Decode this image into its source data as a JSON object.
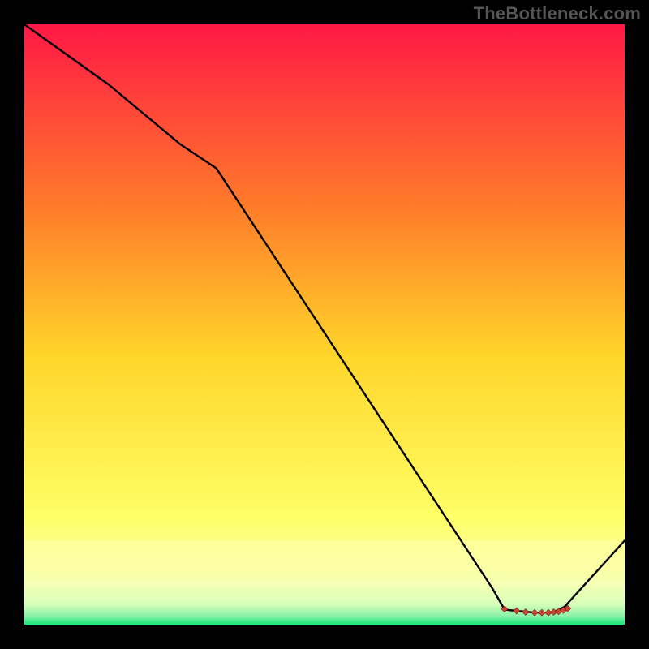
{
  "watermark": "TheBottleneck.com",
  "chart_data": {
    "type": "line",
    "title": "",
    "xlabel": "",
    "ylabel": "",
    "xlim": [
      0,
      100
    ],
    "ylim": [
      0,
      100
    ],
    "grid": false,
    "legend": false,
    "background_gradient": {
      "top": "#ff1846",
      "mid_upper": "#ff7a2a",
      "mid": "#ffd52a",
      "lower": "#ffff66",
      "lowest_band": "#f6ffb3",
      "bottom": "#17e87a"
    },
    "series": [
      {
        "name": "curve",
        "color": "#000000",
        "x": [
          0,
          14,
          26,
          32,
          78,
          80,
          85,
          88,
          90,
          100
        ],
        "y": [
          100,
          90,
          80,
          76,
          6,
          2.5,
          2,
          2,
          3,
          14
        ]
      }
    ],
    "markers": {
      "shape": "diamond",
      "color": "#cc4433",
      "size": 4,
      "x": [
        80,
        82,
        83.5,
        85,
        86.2,
        87.3,
        88.2,
        89,
        89.8,
        90.5
      ],
      "y": [
        2.6,
        2.3,
        2.1,
        2.0,
        2.0,
        2.0,
        2.1,
        2.2,
        2.4,
        2.7
      ]
    }
  }
}
